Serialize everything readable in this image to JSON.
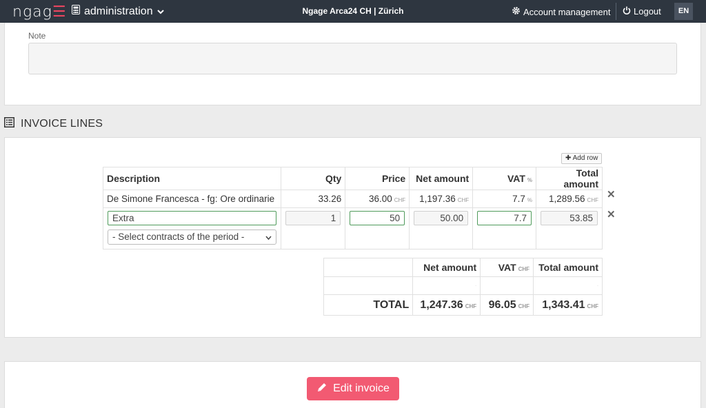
{
  "nav": {
    "logo": "ngag",
    "module": "administration",
    "org": "Ngage Arca24 CH | Zürich",
    "account": "Account management",
    "logout": "Logout",
    "lang": "EN"
  },
  "note": {
    "label": "Note",
    "value": ""
  },
  "invoice_lines": {
    "title": "INVOICE LINES",
    "add_row": "Add row",
    "columns": {
      "description": "Description",
      "qty": "Qty",
      "price": "Price",
      "net": "Net amount",
      "vat": "VAT",
      "vat_unit": "%",
      "total": "Total amount"
    },
    "rows": [
      {
        "description": "De Simone Francesca - fg: Ore ordinarie",
        "qty": "33.26",
        "price": "36.00",
        "price_cur": "CHF",
        "net": "1,197.36",
        "net_cur": "CHF",
        "vat": "7.7",
        "vat_unit": "%",
        "total": "1,289.56",
        "total_cur": "CHF"
      }
    ],
    "edit_row": {
      "description": "Extra",
      "qty": "1",
      "price": "50",
      "net": "50.00",
      "vat": "7.7",
      "total": "53.85",
      "contract_select": "- Select contracts of the period -"
    }
  },
  "totals": {
    "net_header": "Net amount",
    "vat_header": "VAT",
    "vat_unit": "CHF",
    "total_header": "Total amount",
    "label": "TOTAL",
    "net": "1,247.36",
    "vat": "96.05",
    "total": "1,343.41",
    "currency": "CHF"
  },
  "actions": {
    "edit_invoice": "Edit invoice"
  },
  "colors": {
    "nav_bg": "#2e3640",
    "brand": "#e8455f",
    "button": "#f25a72"
  }
}
